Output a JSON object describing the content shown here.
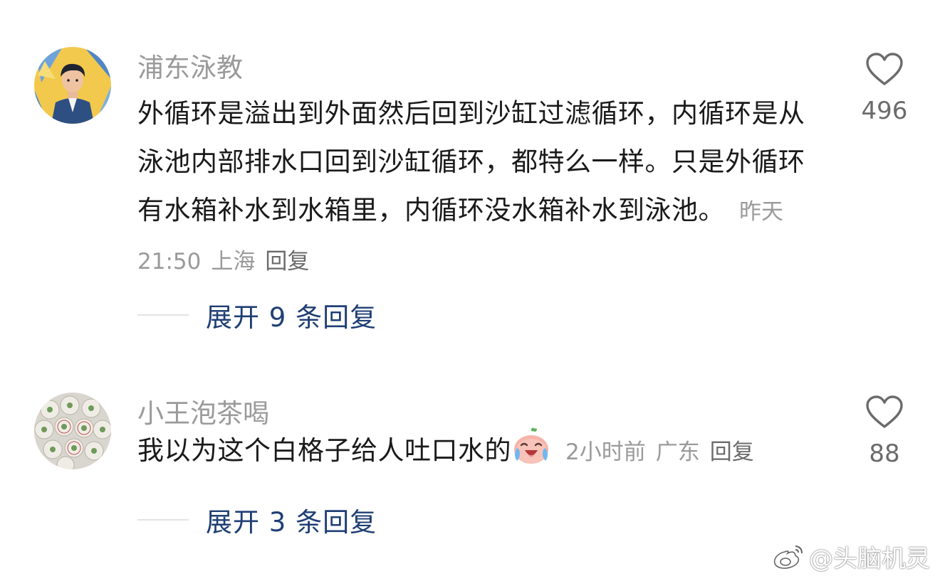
{
  "comments": [
    {
      "username": "浦东泳教",
      "text": "外循环是溢出到外面然后回到沙缸过滤循环，内循环是从泳池内部排水口回到沙缸循环，都特么一样。只是外循环有水箱补水到水箱里，内循环没水箱补水到泳池。",
      "time": "昨天 21:50",
      "location": "上海",
      "reply_label": "回复",
      "like_count": "496",
      "expand_label": "展开 9 条回复",
      "avatar_icon": "avatar-young-man-icon",
      "like_icon": "heart-outline-icon"
    },
    {
      "username": "小王泡茶喝",
      "text": "我以为这个白格子给人吐口水的",
      "emoji_icon": "laughing-crying-face-icon",
      "time": "2小时前",
      "location": "广东",
      "reply_label": "回复",
      "like_count": "88",
      "expand_label": "展开 3 条回复",
      "avatar_icon": "avatar-tea-cakes-icon",
      "like_icon": "heart-outline-icon"
    }
  ],
  "watermark": {
    "text": "@头脑机灵",
    "icon": "weibo-logo-icon"
  },
  "colors": {
    "background": "#ffffff",
    "username": "#9a9a9a",
    "body_text": "#1a1a1a",
    "meta": "#9a9a9a",
    "expand_link": "#1f3f74",
    "like": "#6b6b6b"
  }
}
